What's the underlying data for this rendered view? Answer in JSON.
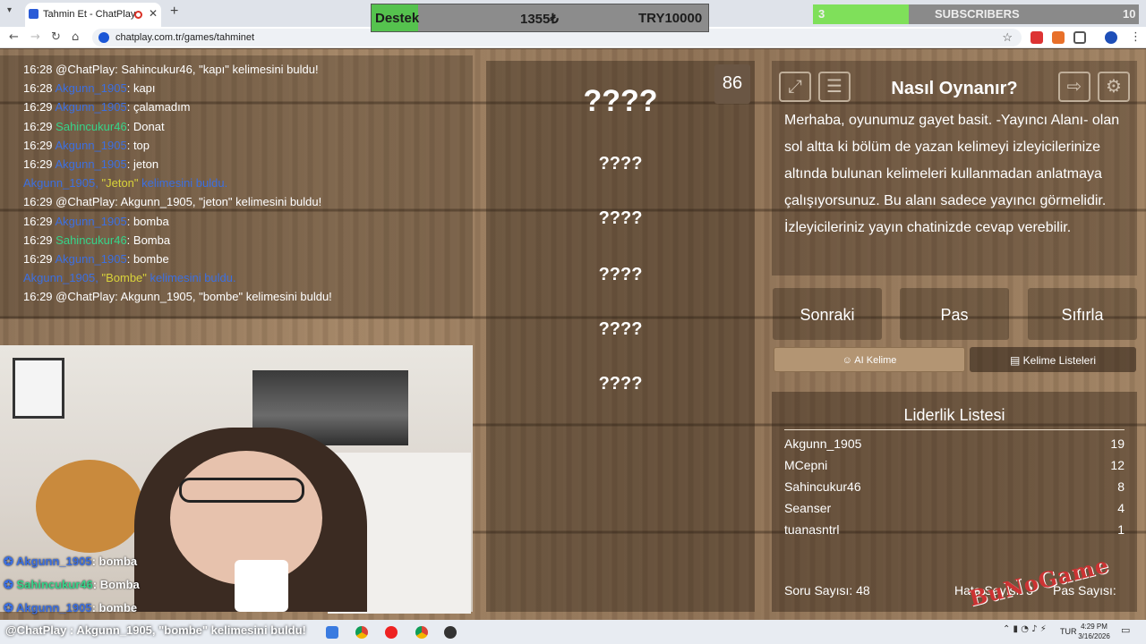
{
  "browser": {
    "tab_title": "Tahmin Et - ChatPlay",
    "url": "chatplay.com.tr/games/tahminet"
  },
  "donation_bar": {
    "label": "Destek",
    "amount": "1355₺",
    "goal": "TRY10000"
  },
  "subscriber_bar": {
    "count": "3",
    "label": "SUBSCRIBERS",
    "goal": "10"
  },
  "chat_log": [
    {
      "time": "16:28",
      "user": "@ChatPlay",
      "color": "#ffffff",
      "sep": ": ",
      "msg": "Sahincukur46, \"kapı\" kelimesini buldu!"
    },
    {
      "time": "16:28",
      "user": "Akgunn_1905",
      "color": "#3c6fe0",
      "sep": ": ",
      "msg": "kapı"
    },
    {
      "time": "16:29",
      "user": "Akgunn_1905",
      "color": "#3c6fe0",
      "sep": ": ",
      "msg": "çalamadım"
    },
    {
      "time": "16:29",
      "user": "Sahincukur46",
      "color": "#36d48a",
      "sep": ": ",
      "msg": "Donat"
    },
    {
      "time": "16:29",
      "user": "Akgunn_1905",
      "color": "#3c6fe0",
      "sep": ": ",
      "msg": "top"
    },
    {
      "time": "16:29",
      "user": "Akgunn_1905",
      "color": "#3c6fe0",
      "sep": ": ",
      "msg": "jeton"
    },
    {
      "time": "",
      "user": "Akgunn_1905",
      "color": "#3c6fe0",
      "sep": ", ",
      "word": "\"Jeton\"",
      "msg": " kelimesini buldu.",
      "found": true
    },
    {
      "time": "16:29",
      "user": "@ChatPlay",
      "color": "#ffffff",
      "sep": ": ",
      "msg": "Akgunn_1905, \"jeton\" kelimesini buldu!"
    },
    {
      "time": "16:29",
      "user": "Akgunn_1905",
      "color": "#3c6fe0",
      "sep": ": ",
      "msg": "bomba"
    },
    {
      "time": "16:29",
      "user": "Sahincukur46",
      "color": "#36d48a",
      "sep": ": ",
      "msg": "Bomba"
    },
    {
      "time": "16:29",
      "user": "Akgunn_1905",
      "color": "#3c6fe0",
      "sep": ": ",
      "msg": "bombe"
    },
    {
      "time": "",
      "user": "Akgunn_1905",
      "color": "#3c6fe0",
      "sep": ", ",
      "word": "\"Bombe\"",
      "msg": " kelimesini buldu.",
      "found": true
    },
    {
      "time": "16:29",
      "user": "@ChatPlay",
      "color": "#ffffff",
      "sep": ": ",
      "msg": "Akgunn_1905, \"bombe\" kelimesini buldu!"
    }
  ],
  "game": {
    "timer": "86",
    "main_word": "????",
    "forbidden_words": [
      "????",
      "????",
      "????",
      "????",
      "????"
    ]
  },
  "help": {
    "title": "Nasıl Oynanır?",
    "text": "Merhaba, oyunumuz gayet basit. -Yayıncı Alanı- olan sol altta ki bölüm de yazan kelimeyi izleyicilerinize altında bulunan kelimeleri kullanmadan anlatmaya çalışıyorsunuz. Bu alanı sadece yayıncı görmelidir. İzleyicileriniz yayın chatinizde cevap verebilir.",
    "icons": [
      "fullscreen-icon",
      "list-icon",
      "exit-icon",
      "gear-icon"
    ]
  },
  "actions": {
    "next": "Sonraki",
    "pass": "Pas",
    "reset": "Sıfırla",
    "ai_word": "AI Kelime",
    "word_lists": "Kelime Listeleri"
  },
  "leaderboard": {
    "title": "Liderlik Listesi",
    "rows": [
      {
        "name": "Akgunn_1905",
        "score": "19"
      },
      {
        "name": "MCepni",
        "score": "12"
      },
      {
        "name": "Sahincukur46",
        "score": "8"
      },
      {
        "name": "Seanser",
        "score": "4"
      },
      {
        "name": "tuanasntrl",
        "score": "1"
      }
    ]
  },
  "stats": {
    "questions": "Soru Sayısı: 48",
    "errors": "Hata Sayısı: 3",
    "passes": "Pas Sayısı:"
  },
  "overlay_chat": [
    {
      "user": "Akgunn_1905",
      "color": "#3c6fe0",
      "msg": ": bomba"
    },
    {
      "user": "Sahincukur46",
      "color": "#36d48a",
      "msg": ": Bomba"
    },
    {
      "user": "Akgunn_1905",
      "color": "#3c6fe0",
      "msg": ": bombe"
    }
  ],
  "ticker": "@ChatPlay : Akgunn_1905, \"bombe\" kelimesini buldu!",
  "watermark": "BuNoGame",
  "taskbar": {
    "lang": "TUR",
    "time": "4:29 PM",
    "date": "3/16/2026"
  }
}
